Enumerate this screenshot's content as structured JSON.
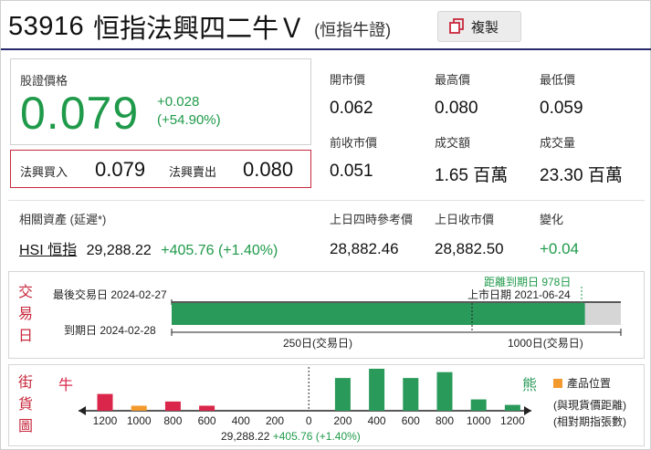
{
  "header": {
    "code": "53916",
    "name": "恒指法興四二牛Ｖ",
    "sub": "(恒指牛證)",
    "copy_label": "複製"
  },
  "price": {
    "label": "股證價格",
    "value": "0.079",
    "change": "+0.028",
    "change_pct": "(+54.90%)"
  },
  "bid_ask": {
    "bid_label": "法興買入",
    "bid": "0.079",
    "ask_label": "法興賣出",
    "ask": "0.080"
  },
  "stats": [
    {
      "label": "開市價",
      "value": "0.062"
    },
    {
      "label": "最高價",
      "value": "0.080"
    },
    {
      "label": "最低價",
      "value": "0.059"
    },
    {
      "label": "前收市價",
      "value": "0.051"
    },
    {
      "label": "成交額",
      "value": "1.65 百萬"
    },
    {
      "label": "成交量",
      "value": "23.30 百萬"
    }
  ],
  "related": {
    "label": "相關資產 (延遲*)",
    "asset": "HSI 恒指",
    "price": "29,288.22",
    "change": "+405.76 (+1.40%)",
    "cols": [
      {
        "label": "上日四時參考價",
        "value": "28,882.46"
      },
      {
        "label": "上日收市價",
        "value": "28,882.50"
      },
      {
        "label": "變化",
        "value": "+0.04"
      }
    ]
  },
  "trading": {
    "side_chars": [
      "交",
      "易",
      "日"
    ],
    "last_trade": "最後交易日 2024-02-27",
    "expiry": "到期日 2024-02-28",
    "days_to_expiry": "距離到期日 978日",
    "listing": "上市日期 2021-06-24",
    "progress": 0.92,
    "tick_250": "250日(交易日)",
    "tick_1000": "1000日(交易日)"
  },
  "street": {
    "side_chars": [
      "街",
      "貨",
      "圖"
    ],
    "bull_label": "牛",
    "bear_label": "熊",
    "legend": "產品位置",
    "note1": "(與現貨價距離)",
    "note2": "(相對期指張數)",
    "center_value": "29,288.22",
    "center_change": "+405.76 (+1.40%)",
    "colors": {
      "bull": "#d9264a",
      "bear": "#2a9a5a",
      "position": "#f39a2e"
    },
    "chart_data": {
      "type": "bar",
      "categories": [
        "1200",
        "1000",
        "800",
        "600",
        "400",
        "200",
        "0",
        "200",
        "400",
        "600",
        "800",
        "1000",
        "1200"
      ],
      "series": [
        {
          "name": "牛",
          "values": [
            0.4,
            0.12,
            0.22,
            0.12,
            0,
            0,
            0,
            0,
            0,
            0,
            0,
            0,
            0
          ]
        },
        {
          "name": "熊",
          "values": [
            0,
            0,
            0,
            0,
            0,
            0,
            0,
            0.78,
            1.0,
            0.78,
            0.92,
            0.27,
            0.14
          ]
        }
      ],
      "highlight_index": 1
    }
  }
}
